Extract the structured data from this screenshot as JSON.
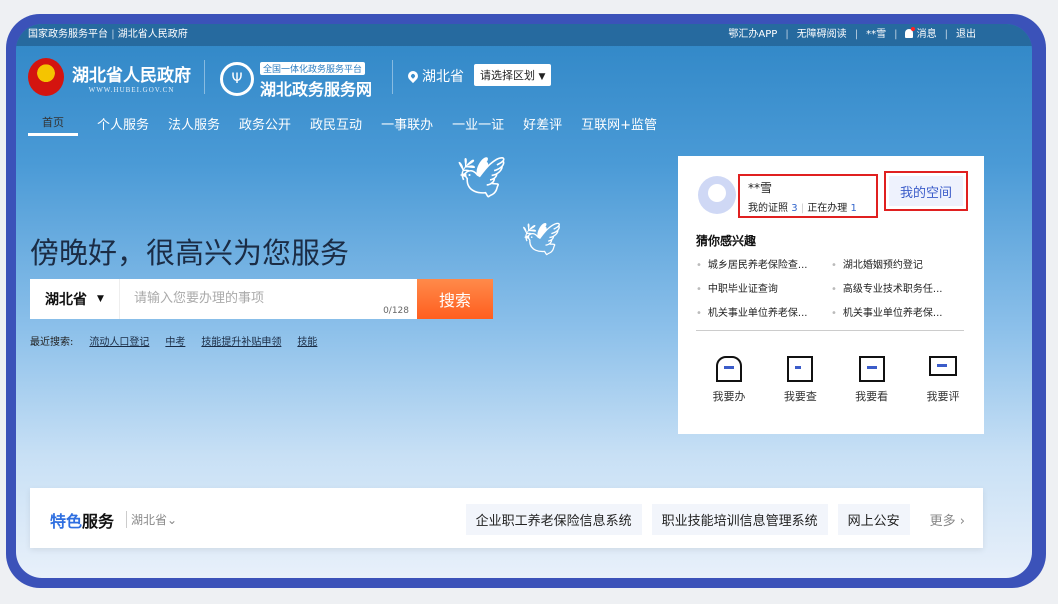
{
  "topbar": {
    "left": [
      "国家政务服务平台",
      "湖北省人民政府"
    ],
    "right": [
      "鄂汇办APP",
      "无障碍阅读",
      "**雪",
      "消息",
      "退出"
    ]
  },
  "header": {
    "gov_name": "湖北省人民政府",
    "gov_url": "WWW.HUBEI.GOV.CN",
    "platform_tag": "全国一体化政务服务平台",
    "site_name": "湖北政务服务网",
    "location": "湖北省",
    "region_select": "请选择区划"
  },
  "nav": [
    "首页",
    "个人服务",
    "法人服务",
    "政务公开",
    "政民互动",
    "一事联办",
    "一业一证",
    "好差评",
    "互联网+监管"
  ],
  "greeting": "傍晚好，很高兴为您服务",
  "search": {
    "province": "湖北省",
    "placeholder": "请输入您要办理的事项",
    "counter": "0/128",
    "button": "搜索",
    "recent_label": "最近搜索:",
    "recent": [
      "流动人口登记",
      "中考",
      "技能提升补贴申领",
      "技能"
    ]
  },
  "user": {
    "name": "**雪",
    "certs_label": "我的证照",
    "certs": "3",
    "doing_label": "正在办理",
    "doing": "1",
    "space": "我的空间",
    "interest_title": "猜你感兴趣",
    "interests": [
      "城乡居民养老保险查...",
      "湖北婚姻预约登记",
      "中职毕业证查询",
      "高级专业技术职务任...",
      "机关事业单位养老保...",
      "机关事业单位养老保..."
    ],
    "actions": [
      {
        "label": "我要办",
        "icon": "bank-icon"
      },
      {
        "label": "我要查",
        "icon": "search-doc-icon"
      },
      {
        "label": "我要看",
        "icon": "view-doc-icon"
      },
      {
        "label": "我要评",
        "icon": "comment-check-icon"
      }
    ]
  },
  "featured": {
    "title_a": "特色",
    "title_b": "服务",
    "province": "湖北省",
    "items": [
      "企业职工养老保险信息系统",
      "职业技能培训信息管理系统",
      "网上公安"
    ],
    "more": "更多"
  },
  "colors": {
    "frame": "#3b52b9",
    "accent": "#2f6fe0",
    "search_button": "#ff6a2b",
    "highlight_border": "#e02020"
  }
}
